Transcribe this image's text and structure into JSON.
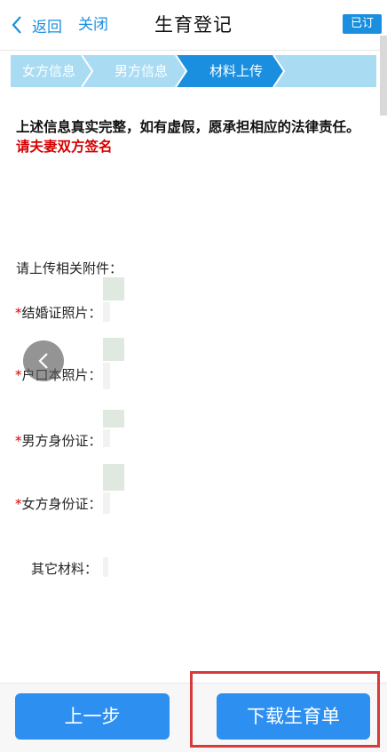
{
  "header": {
    "back_label": "返回",
    "close_label": "关闭",
    "title": "生育登记",
    "badge": "已订"
  },
  "steps": [
    {
      "label": "女方信息"
    },
    {
      "label": "男方信息"
    },
    {
      "label": "材料上传",
      "active": true
    }
  ],
  "notice": {
    "text": "上述信息真实完整，如有虚假，愿承担相应的法律责任。",
    "highlight": "请夫妻双方签名"
  },
  "uploads": {
    "title": "请上传相关附件：",
    "fields": [
      {
        "label": "结婚证照片：",
        "required": true
      },
      {
        "label": "户口本照片：",
        "required": true
      },
      {
        "label": "男方身份证：",
        "required": true
      },
      {
        "label": "女方身份证：",
        "required": true
      },
      {
        "label": "其它材料：",
        "required": false
      }
    ]
  },
  "footer": {
    "prev_label": "上一步",
    "download_label": "下载生育单"
  },
  "colors": {
    "accent": "#2d8ff0",
    "required": "#d40000",
    "step_bg": "#a9dcf3",
    "step_active": "#1a8fe0",
    "highlight_box": "#d63a3a"
  },
  "icons": [
    "chevron-left-icon",
    "arrow-left-icon"
  ]
}
